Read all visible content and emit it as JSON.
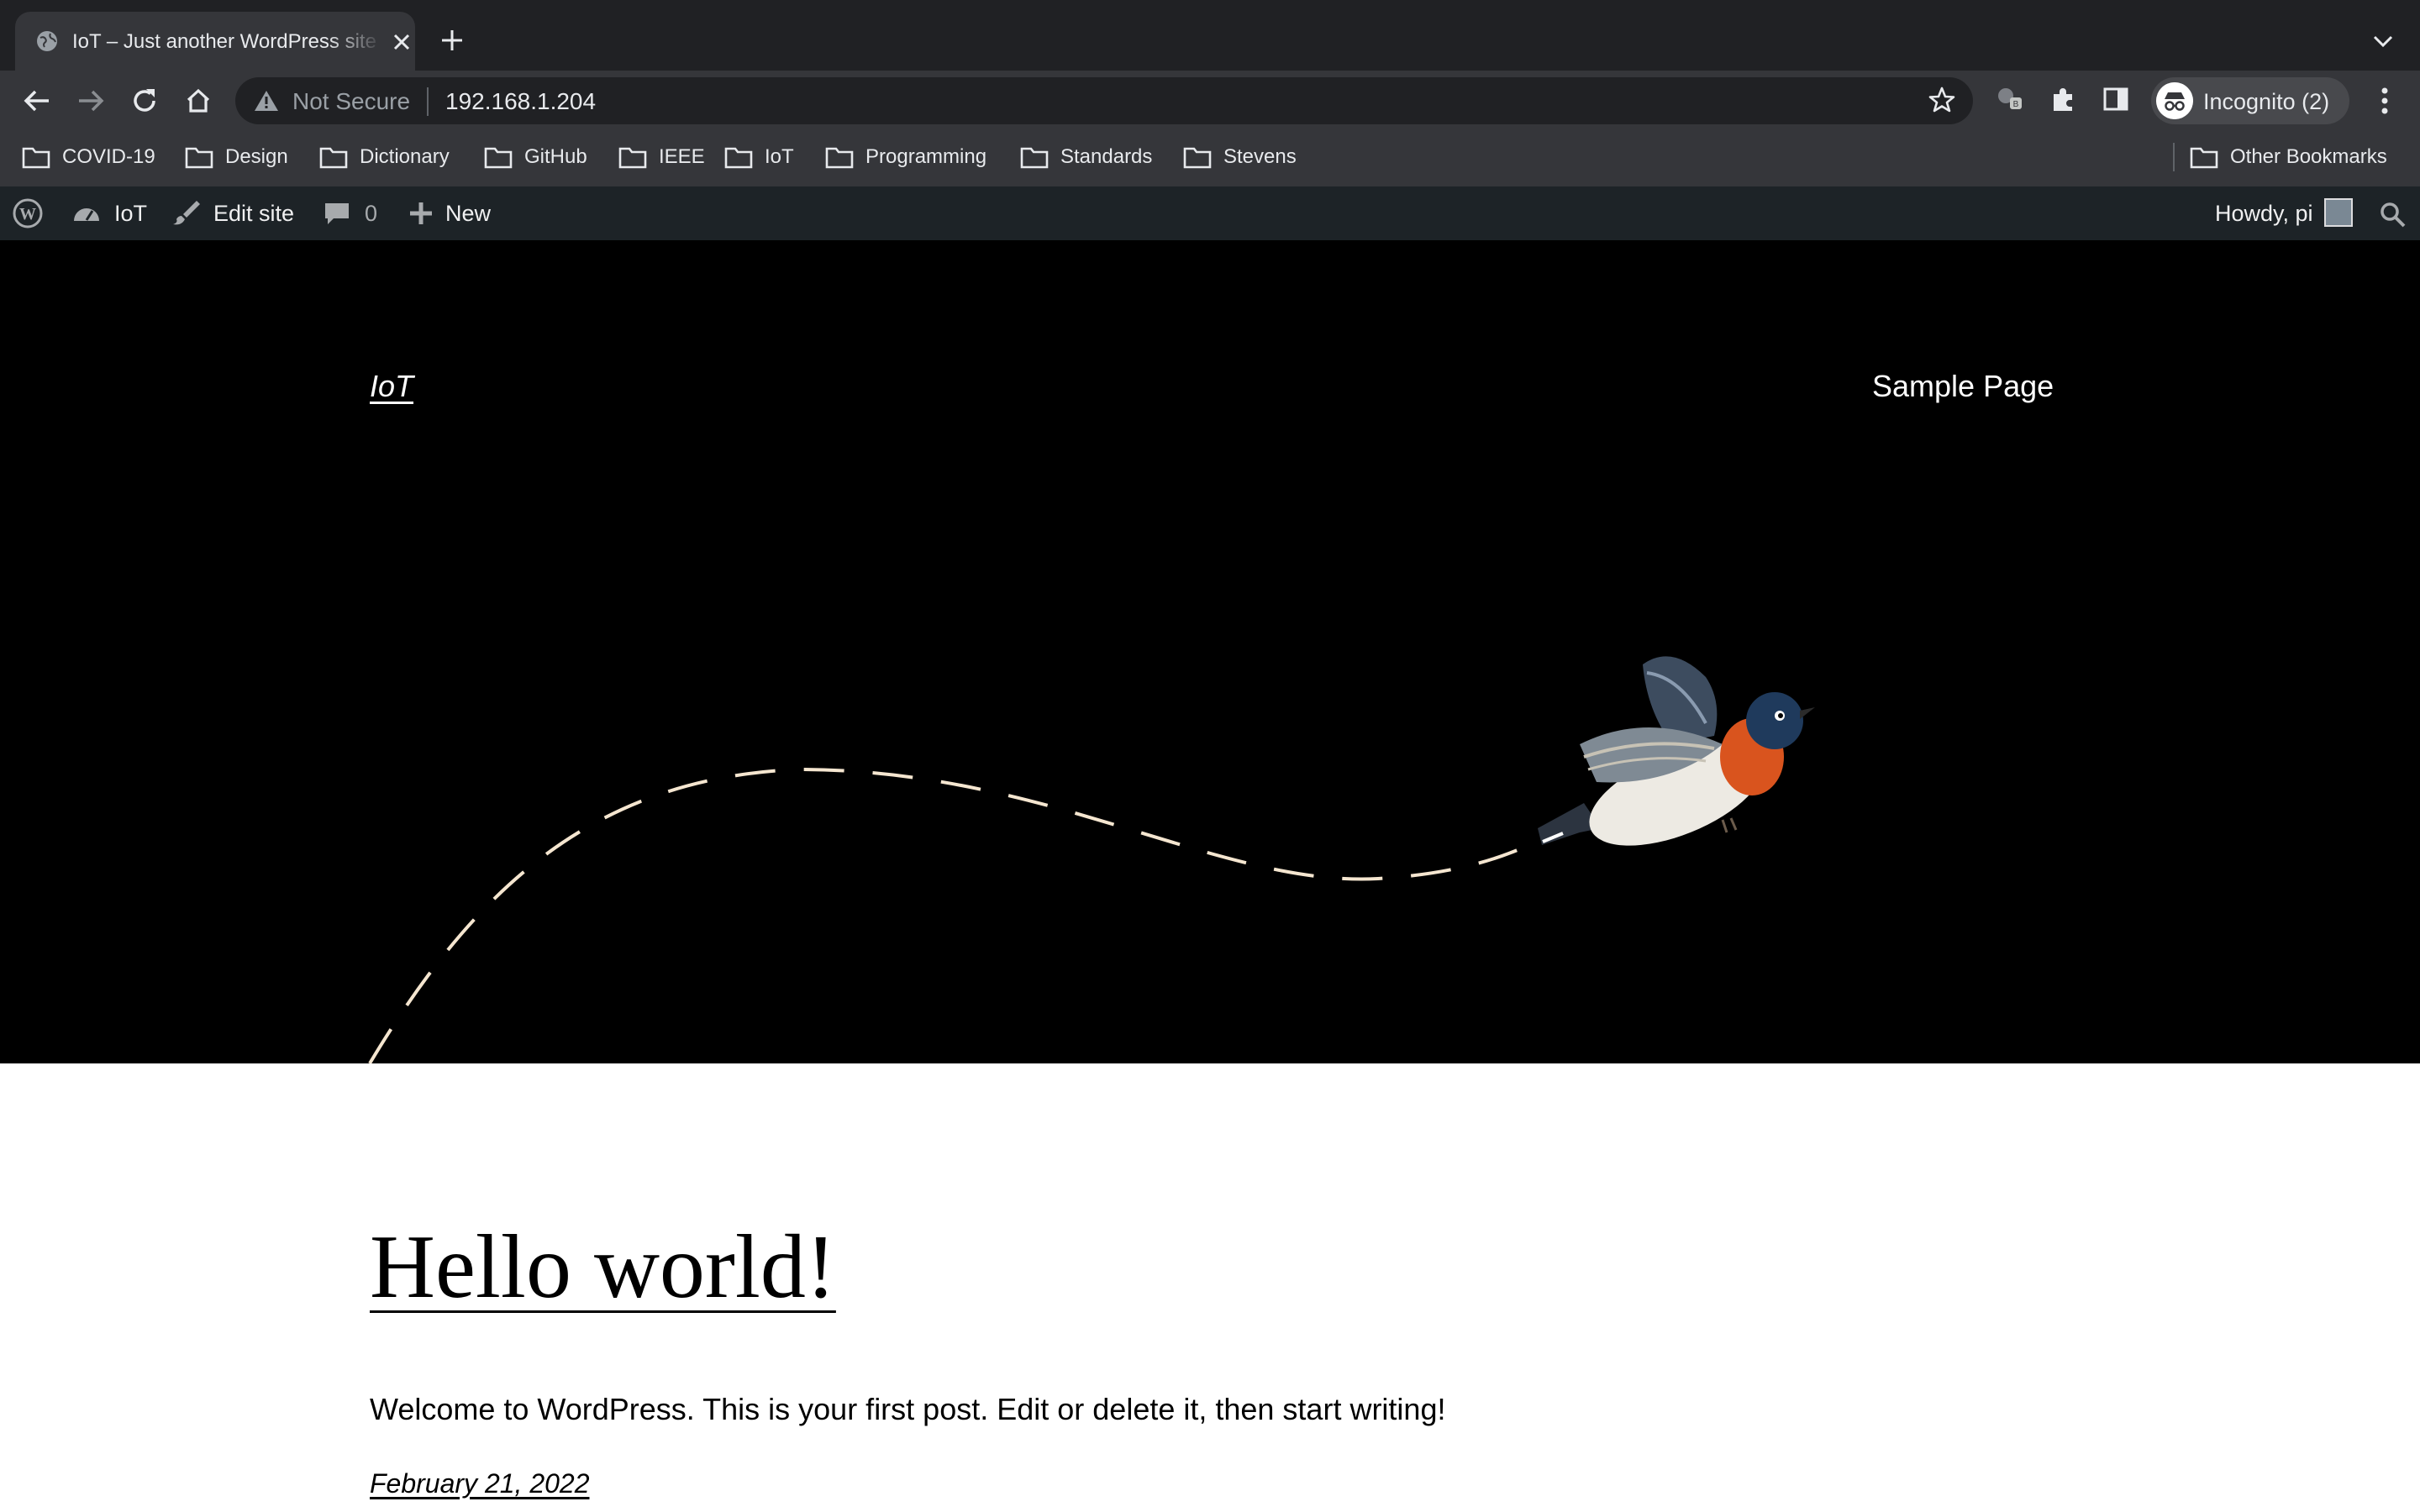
{
  "browser": {
    "tab": {
      "title": "IoT – Just another WordPress site",
      "favicon": "globe-icon"
    },
    "address_bar": {
      "security_label": "Not Secure",
      "url": "192.168.1.204"
    },
    "profile": {
      "label": "Incognito (2)",
      "icon": "incognito-icon"
    },
    "bookmarks": [
      "COVID-19",
      "Design",
      "Dictionary",
      "GitHub",
      "IEEE",
      "IoT",
      "Programming",
      "Standards",
      "Stevens"
    ],
    "other_bookmarks": "Other Bookmarks"
  },
  "admin_bar": {
    "site_name": "IoT",
    "edit_site": "Edit site",
    "comments_count": "0",
    "new_label": "New",
    "greeting": "Howdy, pi"
  },
  "site": {
    "title": "IoT",
    "nav": [
      "Sample Page"
    ],
    "colors": {
      "header_bg": "#000000",
      "dash_line": "#f5e6d0",
      "bird_breast": "#d9541e"
    }
  },
  "post": {
    "title": "Hello world!",
    "excerpt": "Welcome to WordPress. This is your first post. Edit or delete it, then start writing!",
    "date": "February 21, 2022"
  }
}
